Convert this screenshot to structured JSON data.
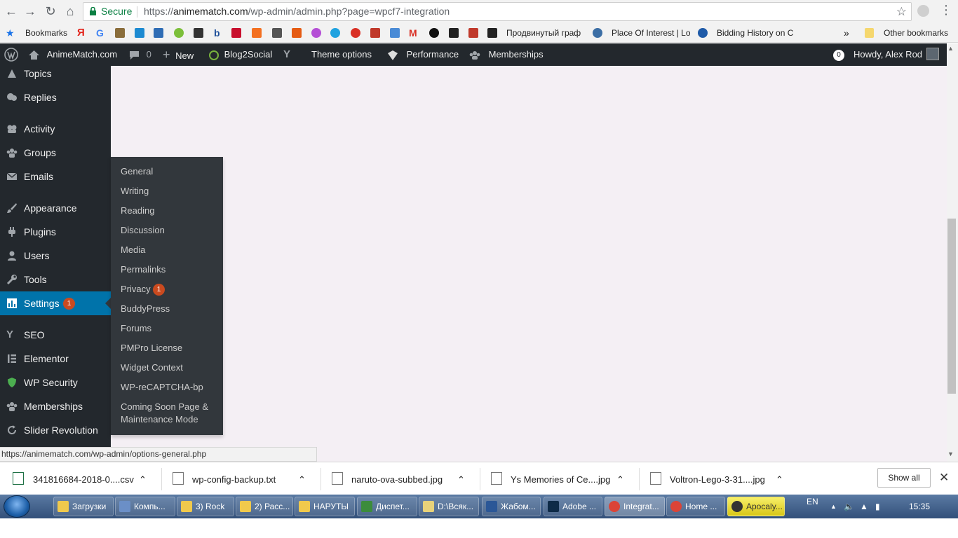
{
  "browser": {
    "secure_label": "Secure",
    "url_prefix": "https://",
    "url_domain": "animematch.com",
    "url_path": "/wp-admin/admin.php?page=wpcf7-integration"
  },
  "bookmarks": {
    "bookmarks_label": "Bookmarks",
    "item_russian": "Продвинутый граф",
    "item_place": "Place Of Interest | Lo",
    "item_bidding": "Bidding History on C",
    "more": "»",
    "other": "Other bookmarks"
  },
  "adminbar": {
    "site": "AnimeMatch.com",
    "comments_count": "0",
    "new_label": "New",
    "blog2social": "Blog2Social",
    "theme_options": "Theme options",
    "performance": "Performance",
    "memberships": "Memberships",
    "notif_count": "0",
    "howdy": "Howdy, Alex Rod"
  },
  "sidebar": {
    "items": [
      {
        "label": "Topics",
        "icon": "topics-icon"
      },
      {
        "label": "Replies",
        "icon": "replies-icon"
      },
      {
        "label": "Activity",
        "icon": "activity-icon"
      },
      {
        "label": "Groups",
        "icon": "groups-icon"
      },
      {
        "label": "Emails",
        "icon": "email-icon"
      },
      {
        "label": "Appearance",
        "icon": "brush-icon"
      },
      {
        "label": "Plugins",
        "icon": "plugin-icon"
      },
      {
        "label": "Users",
        "icon": "user-icon"
      },
      {
        "label": "Tools",
        "icon": "wrench-icon"
      },
      {
        "label": "Settings",
        "icon": "settings-icon",
        "badge": "1"
      },
      {
        "label": "SEO",
        "icon": "yoast-icon"
      },
      {
        "label": "Elementor",
        "icon": "elementor-icon"
      },
      {
        "label": "WP Security",
        "icon": "shield-icon"
      },
      {
        "label": "Memberships",
        "icon": "groups-icon"
      },
      {
        "label": "Slider Revolution",
        "icon": "refresh-icon"
      }
    ]
  },
  "settings_menu": {
    "items": [
      "General",
      "Writing",
      "Reading",
      "Discussion",
      "Media",
      "Permalinks",
      "Privacy",
      "BuddyPress",
      "Forums",
      "PMPro License",
      "Widget Context",
      "WP-reCAPTCHA-bp",
      "Coming Soon Page &",
      "Maintenance Mode"
    ],
    "privacy_badge": "1"
  },
  "status_url": "https://animematch.com/wp-admin/options-general.php",
  "downloads": {
    "files": [
      "341816684-2018-0....csv",
      "wp-config-backup.txt",
      "naruto-ova-subbed.jpg",
      "Ys Memories of Ce....jpg",
      "Voltron-Lego-3-31....jpg"
    ],
    "show_all": "Show all"
  },
  "taskbar": {
    "items": [
      "Загрузки",
      "Компь...",
      "3) Rock",
      "2) Расс...",
      "НАРУТЫ",
      "Диспет...",
      "D:\\Всяк...",
      "Жабом...",
      "Adobe ...",
      "Integrat...",
      "Home ...",
      "Apocaly..."
    ],
    "lang": "EN",
    "time": "15:35"
  },
  "colors": {
    "adminbar": "#23282d",
    "sidebar": "#23282d",
    "settings_active": "#0073aa",
    "flyout": "#32373c",
    "badge": "#ca4a1f",
    "content_bg": "#f4eff4"
  }
}
